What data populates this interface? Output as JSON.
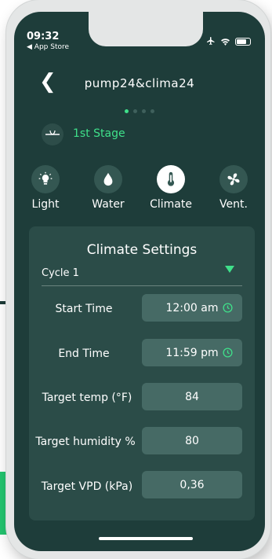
{
  "status": {
    "time": "09:32",
    "back_app": "◀ App Store"
  },
  "header": {
    "back_glyph": "❮",
    "title": "pump24&clima24"
  },
  "pager": {
    "total": 4,
    "active": 0
  },
  "stage": {
    "label": "1st Stage"
  },
  "tabs": [
    {
      "label": "Light",
      "icon": "light-bulb-icon"
    },
    {
      "label": "Water",
      "icon": "water-drop-icon"
    },
    {
      "label": "Climate",
      "icon": "thermometer-icon",
      "active": true
    },
    {
      "label": "Vent.",
      "icon": "fan-icon"
    }
  ],
  "settings": {
    "title": "Climate Settings",
    "cycle": "Cycle 1",
    "start_time": {
      "label": "Start Time",
      "value": "12:00 am"
    },
    "end_time": {
      "label": "End Time",
      "value": "11:59 pm"
    },
    "target_temp": {
      "label": "Target temp (°F)",
      "value": "84"
    },
    "target_humidity": {
      "label": "Target humidity %",
      "value": "80"
    },
    "target_vpd": {
      "label": "Target VPD (kPa)",
      "value": "0,36"
    }
  },
  "colors": {
    "accent": "#3fe08a",
    "background": "#1e3d3a",
    "card": "#2b4c48",
    "field": "#466a65"
  }
}
